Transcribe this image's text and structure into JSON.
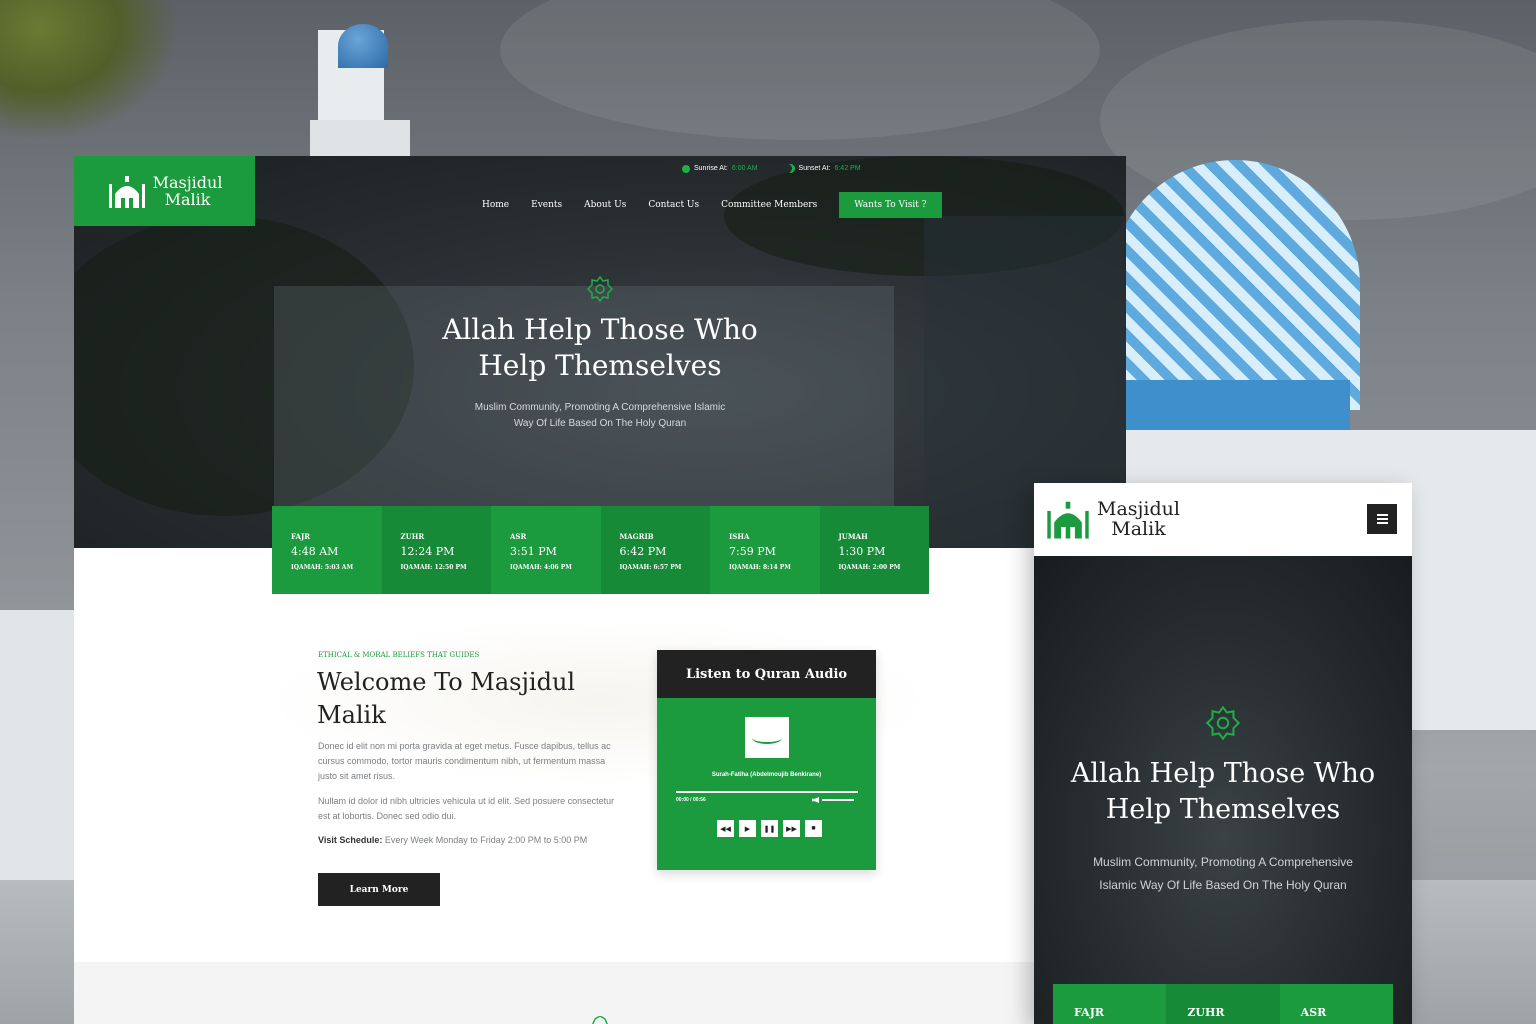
{
  "brand": {
    "name_line1": "Masjidul",
    "name_line2": "Malik",
    "color_primary": "#1b9b3e",
    "color_dark": "#222222"
  },
  "topbar": {
    "sunrise_label": "Sunrise At:",
    "sunrise_value": "6:00 AM",
    "sunset_label": "Sunset At:",
    "sunset_value": "6:42 PM"
  },
  "nav": {
    "items": [
      "Home",
      "Events",
      "About Us",
      "Contact Us",
      "Committee Members"
    ],
    "cta": "Wants To Visit ?"
  },
  "hero": {
    "title_line1": "Allah Help Those Who",
    "title_line2": "Help Themselves",
    "subtitle_line1": "Muslim Community, Promoting A Comprehensive Islamic",
    "subtitle_line2": "Way Of Life Based On The Holy Quran",
    "icon": "gear-ornament-icon"
  },
  "prayers": [
    {
      "name": "FAJR",
      "time": "4:48 AM",
      "iqamah": "IQAMAH: 5:03 AM"
    },
    {
      "name": "ZUHR",
      "time": "12:24 PM",
      "iqamah": "IQAMAH: 12:50 PM"
    },
    {
      "name": "ASR",
      "time": "3:51 PM",
      "iqamah": "IQAMAH: 4:06 PM"
    },
    {
      "name": "MAGRIB",
      "time": "6:42 PM",
      "iqamah": "IQAMAH: 6:57 PM"
    },
    {
      "name": "ISHA",
      "time": "7:59 PM",
      "iqamah": "IQAMAH: 8:14 PM"
    },
    {
      "name": "JUMAH",
      "time": "1:30 PM",
      "iqamah": "IQAMAH: 2:00 PM"
    }
  ],
  "about": {
    "eyebrow": "ETHICAL & MORAL BELIEFS THAT GUIDES",
    "title_line1": "Welcome To Masjidul",
    "title_line2": "Malik",
    "para1": "Donec id elit non mi porta gravida at eget metus. Fusce dapibus, tellus ac cursus commodo, tortor mauris condimentum nibh, ut fermentum massa justo sit amet risus.",
    "para2": "Nullam id dolor id nibh ultricies vehicula ut id elit. Sed posuere consectetur est at lobortis. Donec sed odio dui.",
    "schedule_label": "Visit Schedule:",
    "schedule_value": "Every Week Monday to Friday 2:00 PM to 5:00 PM",
    "button": "Learn More"
  },
  "quran": {
    "heading": "Listen to Quran Audio",
    "track": "Surah-Fatiha (Abdelmoujib Benkirane)",
    "timing": "00:00 / 00:56",
    "progress": 0.0,
    "volume": 1.0,
    "controls": [
      "rewind-icon",
      "play-icon",
      "pause-icon",
      "forward-icon",
      "stop-icon"
    ]
  },
  "mobile": {
    "menu_icon": "hamburger-menu-icon",
    "prayers": [
      "FAJR",
      "ZUHR",
      "ASR"
    ]
  }
}
